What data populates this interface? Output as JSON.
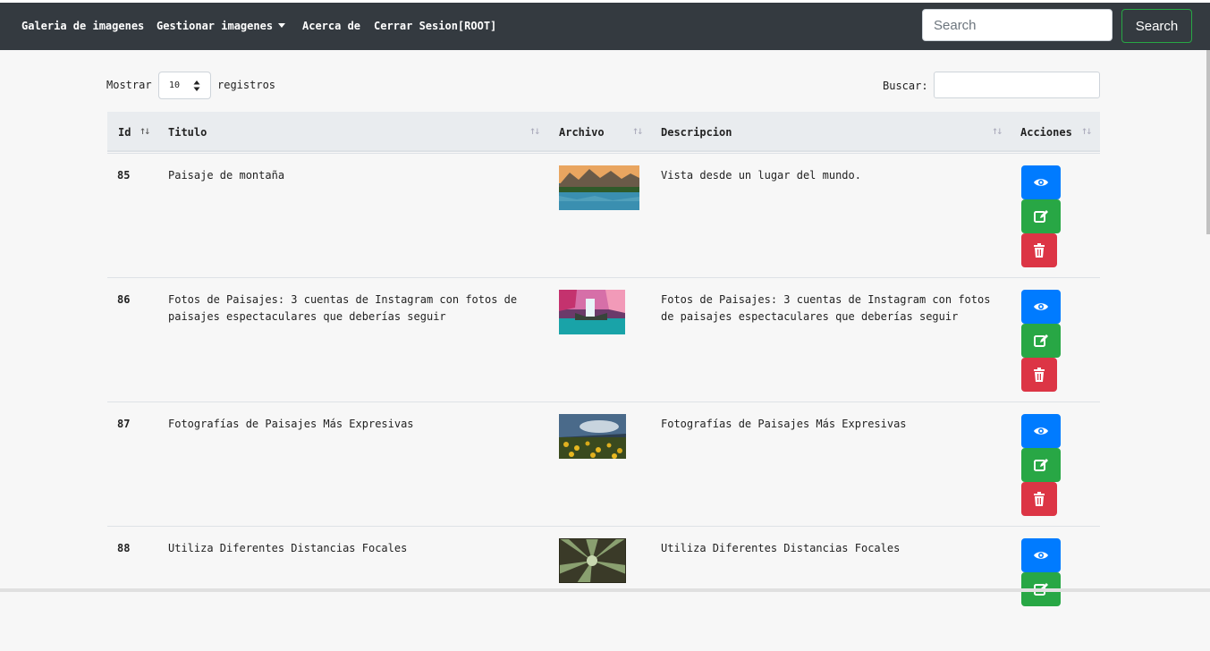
{
  "nav": {
    "brand": "Galeria de imagenes",
    "manage": "Gestionar imagenes",
    "about": "Acerca de",
    "logout": "Cerrar Sesion[ROOT]",
    "search_placeholder": "Search",
    "search_button": "Search"
  },
  "controls": {
    "show_label": "Mostrar",
    "page_length": "10",
    "records_label": "registros",
    "filter_label": "Buscar:"
  },
  "table": {
    "headers": {
      "id": "Id",
      "title": "Titulo",
      "file": "Archivo",
      "description": "Descripcion",
      "actions": "Acciones"
    },
    "sort_glyph": "↑↓",
    "rows": [
      {
        "id": "85",
        "title": "Paisaje de montaña",
        "description": "Vista desde un lugar del mundo.",
        "image": "mountain-lake-thumbnail"
      },
      {
        "id": "86",
        "title": "Fotos de Paisajes: 3 cuentas de Instagram con fotos de paisajes espectaculares que deberías seguir",
        "description": "Fotos de Paisajes: 3 cuentas de Instagram con fotos de paisajes espectaculares que deberías seguir",
        "image": "waterfall-thumbnail"
      },
      {
        "id": "87",
        "title": "Fotografías de Paisajes Más Expresivas",
        "description": "Fotografías de Paisajes Más Expresivas",
        "image": "sunflower-field-thumbnail"
      },
      {
        "id": "88",
        "title": "Utiliza Diferentes Distancias Focales",
        "description": "Utiliza Diferentes Distancias Focales",
        "image": "forest-canopy-thumbnail"
      }
    ]
  },
  "icons": {
    "view": "eye-icon",
    "edit": "edit-icon",
    "delete": "trash-icon"
  },
  "colors": {
    "navbar": "#343a40",
    "primary": "#007bff",
    "success": "#28a745",
    "danger": "#dc3545"
  }
}
